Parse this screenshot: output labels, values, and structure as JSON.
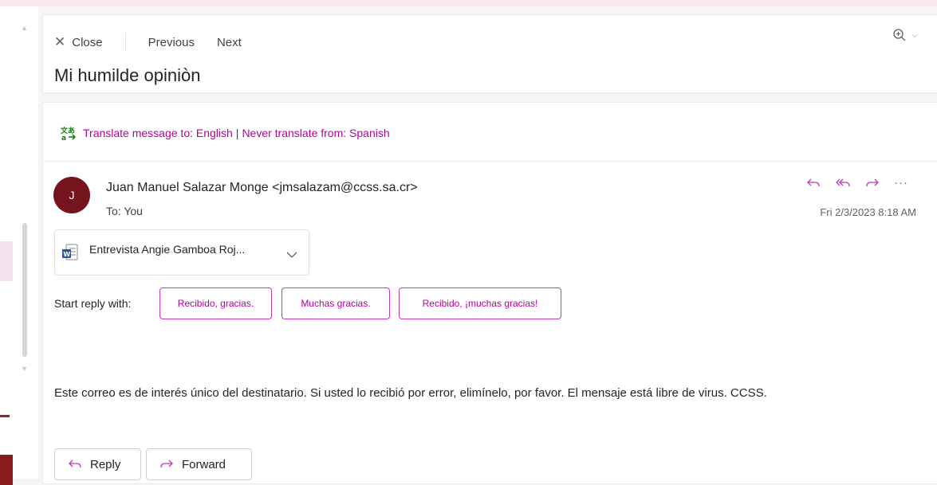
{
  "toolbar": {
    "close_label": "Close",
    "previous_label": "Previous",
    "next_label": "Next"
  },
  "message": {
    "subject": "Mi humilde opiniòn",
    "translate_prompt": "Translate message to: English",
    "never_translate": "Never translate from: Spanish",
    "avatar_initial": "J",
    "sender": "Juan Manuel Salazar Monge <jmsalazam@ccss.sa.cr>",
    "to": "To: You",
    "date": "Fri 2/3/2023 8:18 AM",
    "attachment_name": "Entrevista Angie Gamboa Roj...",
    "body": "Este correo es de interés único del destinatario. Si usted lo recibió por error, elimínelo, por favor. El mensaje está libre de virus. CCSS."
  },
  "quick_replies": {
    "label": "Start reply with:",
    "options": [
      "Recibido, gracias.",
      "Muchas gracias.",
      "Recibido, ¡muchas gracias!"
    ]
  },
  "footer": {
    "reply_label": "Reply",
    "forward_label": "Forward"
  },
  "colors": {
    "accent": "#b4009e",
    "avatar": "#75141c"
  }
}
